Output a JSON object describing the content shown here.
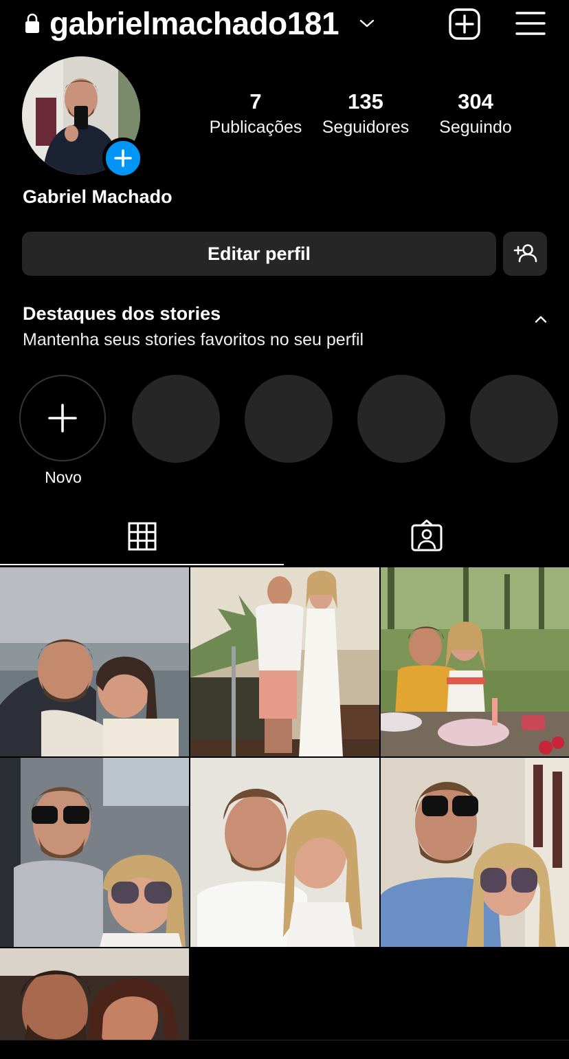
{
  "header": {
    "username": "gabrielmachado181"
  },
  "profile": {
    "display_name": "Gabriel Machado",
    "stats": {
      "posts_count": "7",
      "posts_label": "Publicações",
      "followers_count": "135",
      "followers_label": "Seguidores",
      "following_count": "304",
      "following_label": "Seguindo"
    }
  },
  "actions": {
    "edit_profile_label": "Editar perfil"
  },
  "highlights": {
    "title": "Destaques dos stories",
    "subtitle": "Mantenha seus stories favoritos no seu perfil",
    "new_label": "Novo"
  },
  "tabs": [
    {
      "name": "posts-grid",
      "icon": "grid-icon",
      "active": true
    },
    {
      "name": "tagged",
      "icon": "person-tag-icon",
      "active": false
    }
  ],
  "colors": {
    "background": "#000000",
    "button_bg": "#262626",
    "accent_blue": "#0095f6",
    "placeholder": "#262626"
  }
}
